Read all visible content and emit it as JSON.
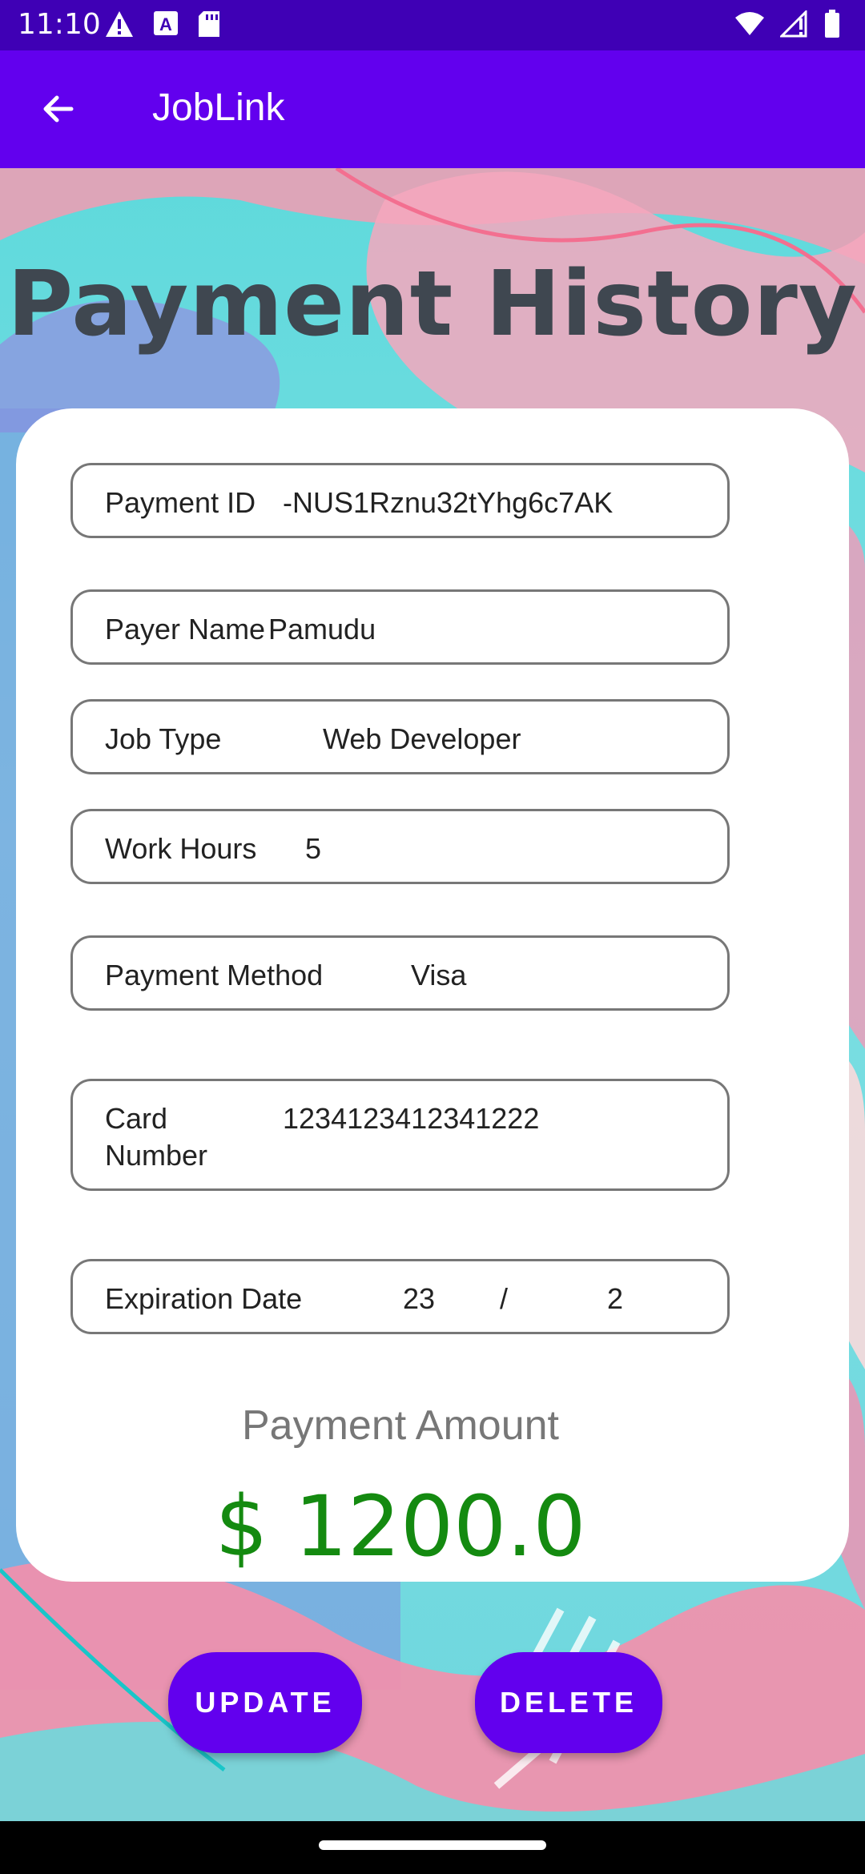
{
  "status_bar": {
    "time": "11:10",
    "icons": [
      "alert-icon",
      "a-box-icon",
      "sd-card-icon",
      "wifi-icon",
      "no-signal-icon",
      "battery-icon"
    ]
  },
  "app_bar": {
    "title": "JobLink",
    "back_icon": "arrow-left-icon"
  },
  "page": {
    "heading": "Payment History"
  },
  "fields": {
    "payment_id": {
      "label": "Payment ID",
      "value": "-NUS1Rznu32tYhg6c7AK"
    },
    "payer_name": {
      "label": "Payer Name",
      "value": "Pamudu"
    },
    "job_type": {
      "label": "Job Type",
      "value": "Web Developer"
    },
    "work_hours": {
      "label": "Work Hours",
      "value": "5"
    },
    "payment_method": {
      "label": "Payment Method",
      "value": "Visa"
    },
    "card_number": {
      "label_line1": "Card",
      "label_line2": "Number",
      "value": "1234123412341222"
    },
    "expiration": {
      "label": "Expiration Date",
      "month": "23",
      "separator": "/",
      "year": "2"
    }
  },
  "amount": {
    "label": "Payment Amount",
    "value": "$ 1200.0"
  },
  "buttons": {
    "update": "UPDATE",
    "delete": "DELETE"
  },
  "colors": {
    "primary": "#6200ee",
    "status_bar": "#3f00b5",
    "amount_green": "#148a10"
  }
}
